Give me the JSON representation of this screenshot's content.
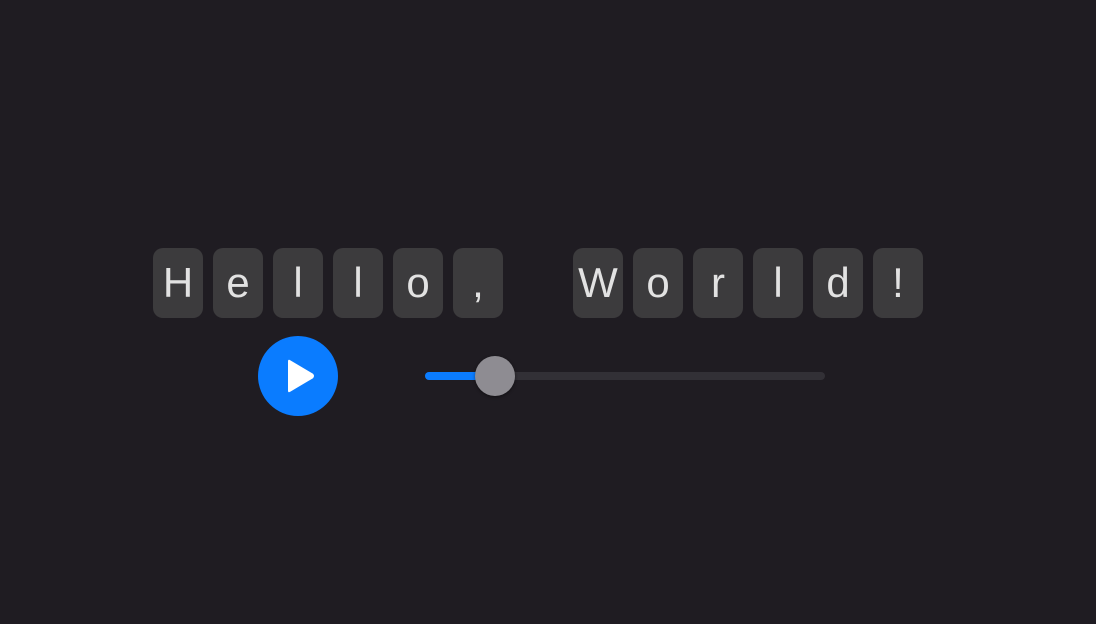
{
  "message": {
    "characters": [
      "H",
      "e",
      "l",
      "l",
      "o",
      ",",
      " ",
      "W",
      "o",
      "r",
      "l",
      "d",
      "!"
    ]
  },
  "player": {
    "play_icon": "play-icon",
    "progress": 0.175
  },
  "colors": {
    "background": "#1f1c22",
    "tile": "#3c3b3d",
    "tile_text": "#e2e2e2",
    "accent": "#0a7cff",
    "track": "#323036",
    "thumb": "#8e8c92"
  }
}
